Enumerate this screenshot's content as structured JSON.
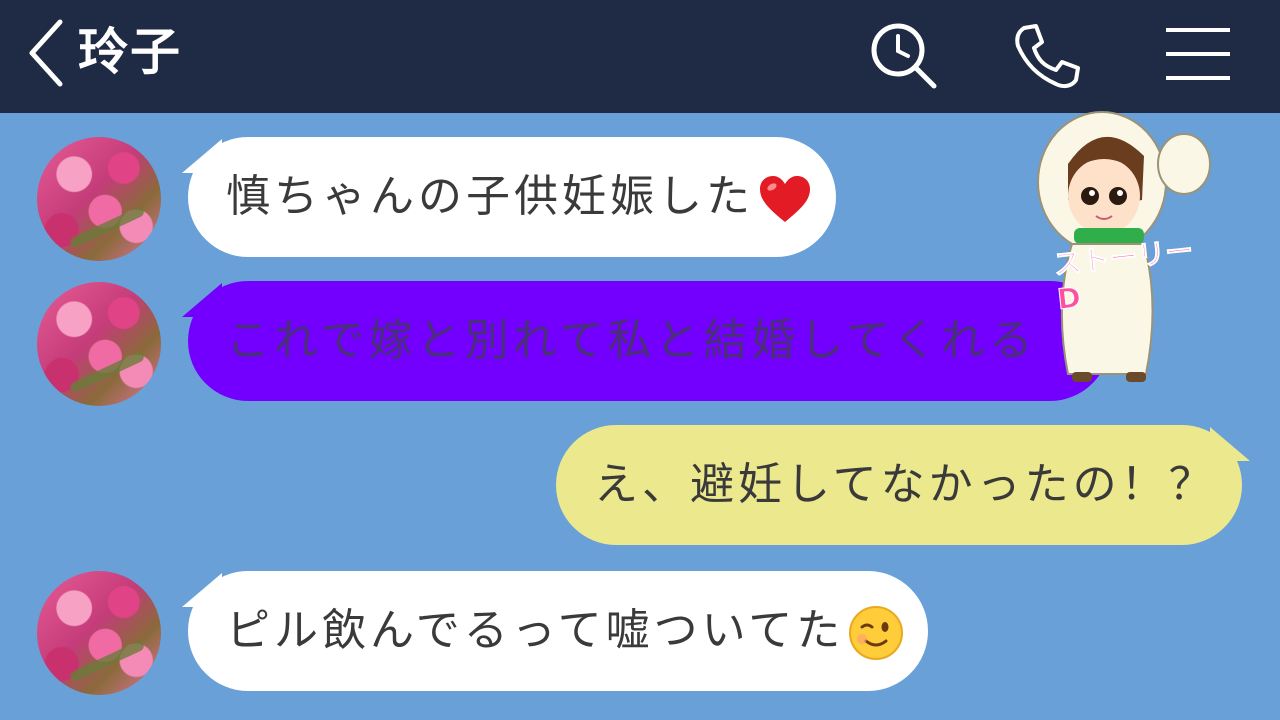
{
  "header": {
    "title": "玲子",
    "icons": [
      "back-icon",
      "search-icon",
      "phone-icon",
      "menu-icon"
    ]
  },
  "messages": [
    {
      "side": "left",
      "text": "慎ちゃんの子供妊娠した",
      "emoji": "heart",
      "color": "#ffffff"
    },
    {
      "side": "left",
      "text": "これで嫁と別れて私と結婚してくれる",
      "color": "#7300ff"
    },
    {
      "side": "right",
      "text": "え、避妊してなかったの！？",
      "color": "#ebe88e"
    },
    {
      "side": "left",
      "text": "ピル飲んでるって嘘ついてた",
      "emoji": "winking-face",
      "color": "#ffffff"
    }
  ],
  "overlay": {
    "text": "ストーリーD"
  },
  "colors": {
    "header": "#1f2a44",
    "background": "#6aa0d8"
  }
}
